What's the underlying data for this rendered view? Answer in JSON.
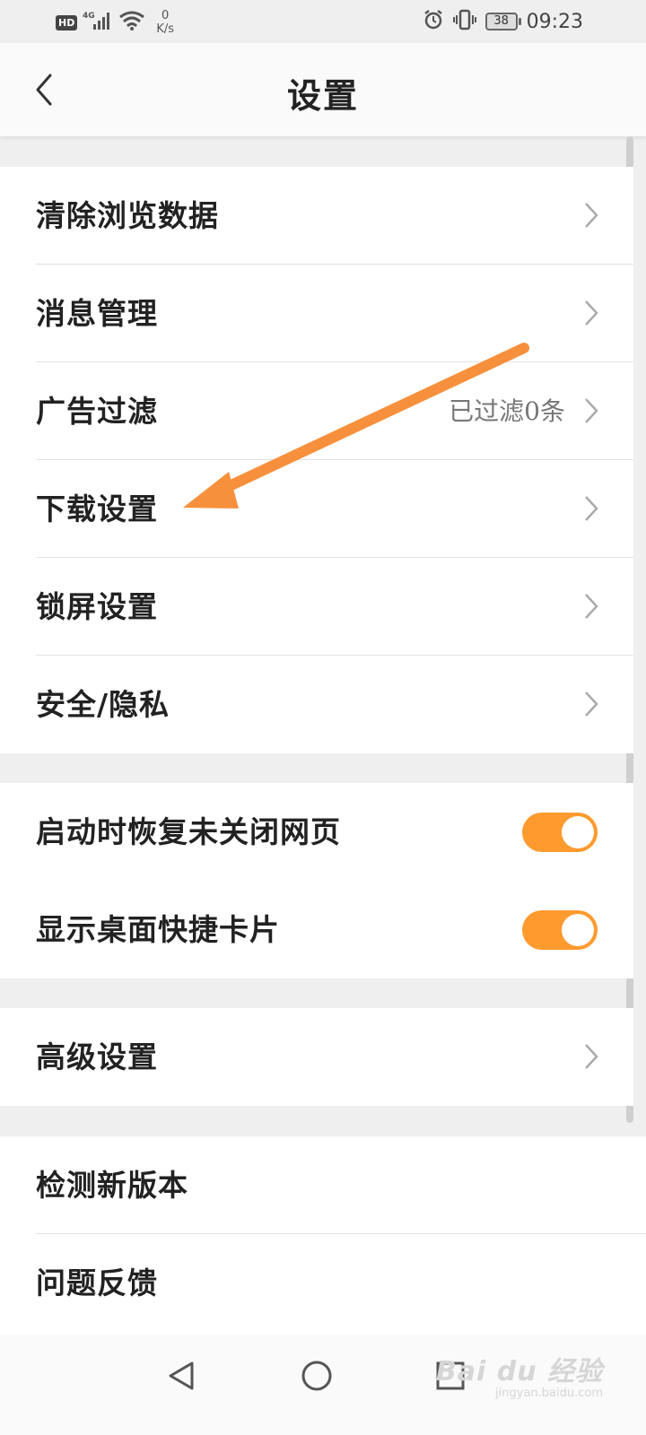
{
  "status_bar": {
    "hd_badge": "HD",
    "network_type": "4G",
    "net_speed_value": "0",
    "net_speed_unit": "K/s",
    "battery_level": "38",
    "time": "09:23",
    "icons": [
      "signal-icon",
      "wifi-icon",
      "alarm-icon",
      "vibrate-icon",
      "battery-icon"
    ]
  },
  "header": {
    "title": "设置"
  },
  "groups": {
    "general": [
      {
        "label": "清除浏览数据"
      },
      {
        "label": "消息管理"
      },
      {
        "label": "广告过滤",
        "value": "已过滤0条"
      },
      {
        "label": "下载设置"
      },
      {
        "label": "锁屏设置"
      },
      {
        "label": "安全/隐私"
      }
    ],
    "toggles": [
      {
        "label": "启动时恢复未关闭网页",
        "enabled": true
      },
      {
        "label": "显示桌面快捷卡片",
        "enabled": true
      }
    ],
    "advanced": [
      {
        "label": "高级设置"
      }
    ],
    "about": [
      {
        "label": "检测新版本"
      },
      {
        "label": "问题反馈"
      }
    ]
  },
  "annotation": {
    "arrow_color": "#f7903c",
    "points_to": "下载设置"
  },
  "colors": {
    "accent": "#ff9a2e",
    "background": "#efefef",
    "card": "#ffffff"
  },
  "watermark": {
    "main": "Bai du 经验",
    "sub": "jingyan.baidu.com"
  }
}
